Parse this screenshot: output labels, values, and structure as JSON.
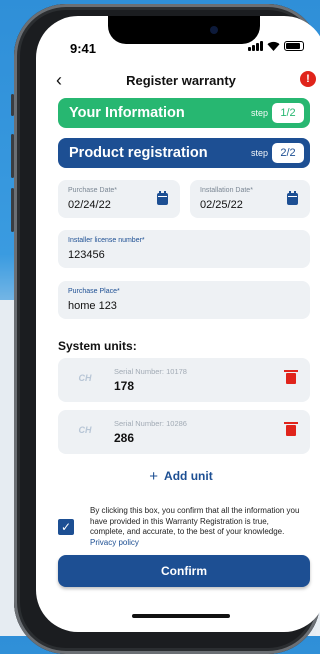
{
  "status": {
    "time": "9:41"
  },
  "header": {
    "title": "Register warranty",
    "back": "‹",
    "info": "!"
  },
  "steps": [
    {
      "title": "Your Information",
      "label": "step",
      "num": "1/2"
    },
    {
      "title": "Product registration",
      "label": "step",
      "num": "2/2"
    }
  ],
  "form": {
    "purchase_date": {
      "label": "Purchase Date*",
      "value": "02/24/22"
    },
    "installation_date": {
      "label": "Installation Date*",
      "value": "02/25/22"
    },
    "installer_license": {
      "label": "Installer license number*",
      "value": "123456"
    },
    "purchase_place": {
      "label": "Purchase Place*",
      "value": "home 123"
    }
  },
  "system_units": {
    "title": "System units:",
    "items": [
      {
        "serial_label": "Serial Number: 10178",
        "code": "178",
        "logo": "CH"
      },
      {
        "serial_label": "Serial Number: 10286",
        "code": "286",
        "logo": "CH"
      }
    ],
    "add_label": "Add unit",
    "add_icon": "+"
  },
  "consent": {
    "text": "By clicking this box, you confirm that all the information you have provided in this Warranty Registration is true, complete, and accurate, to the best of your knowledge.",
    "link": "Privacy policy",
    "checked": true,
    "check_glyph": "✓"
  },
  "confirm_label": "Confirm",
  "colors": {
    "brand": "#1d4f93",
    "success": "#27b771",
    "danger": "#e0241b"
  }
}
